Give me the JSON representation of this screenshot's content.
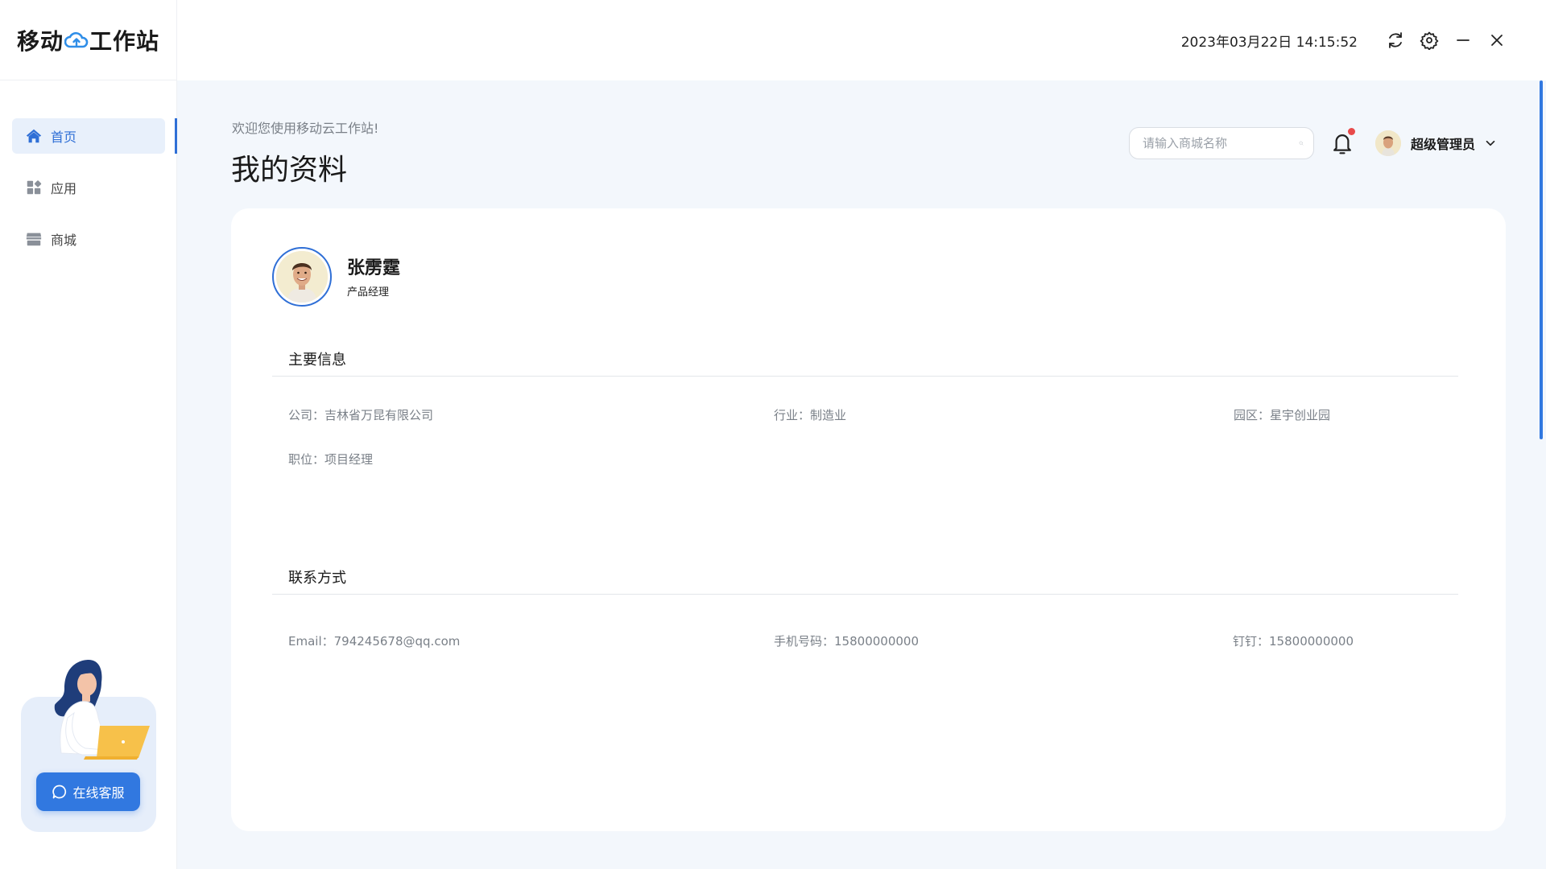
{
  "app": {
    "logo_left": "移动",
    "logo_right": "工作站",
    "datetime": "2023年03月22日 14:15:52"
  },
  "sidebar": {
    "items": [
      {
        "label": "首页",
        "icon": "home-icon",
        "active": true
      },
      {
        "label": "应用",
        "icon": "apps-grid-icon",
        "active": false
      },
      {
        "label": "商城",
        "icon": "store-icon",
        "active": false
      }
    ],
    "support_label": "在线客服"
  },
  "header": {
    "welcome": "欢迎您使用移动云工作站!",
    "title": "我的资料",
    "search_placeholder": "请输入商城名称",
    "user_name": "超级管理员"
  },
  "profile": {
    "name": "张雳霆",
    "role": "产品经理",
    "sections": [
      {
        "title": "主要信息",
        "fields": [
          {
            "label": "公司：",
            "value": "吉林省万昆有限公司"
          },
          {
            "label": "行业：",
            "value": "制造业"
          },
          {
            "label": "园区：",
            "value": "星宇创业园"
          },
          {
            "label": "职位：",
            "value": "项目经理"
          }
        ]
      },
      {
        "title": "联系方式",
        "fields": [
          {
            "label": "Email：",
            "value": "794245678@qq.com"
          },
          {
            "label": "手机号码：",
            "value": "15800000000"
          },
          {
            "label": "钉钉：",
            "value": "15800000000"
          }
        ]
      }
    ]
  },
  "colors": {
    "accent": "#3178e0",
    "active_bg": "#e8f0fb",
    "page_bg": "#f3f7fc",
    "badge": "#e84a4a"
  }
}
